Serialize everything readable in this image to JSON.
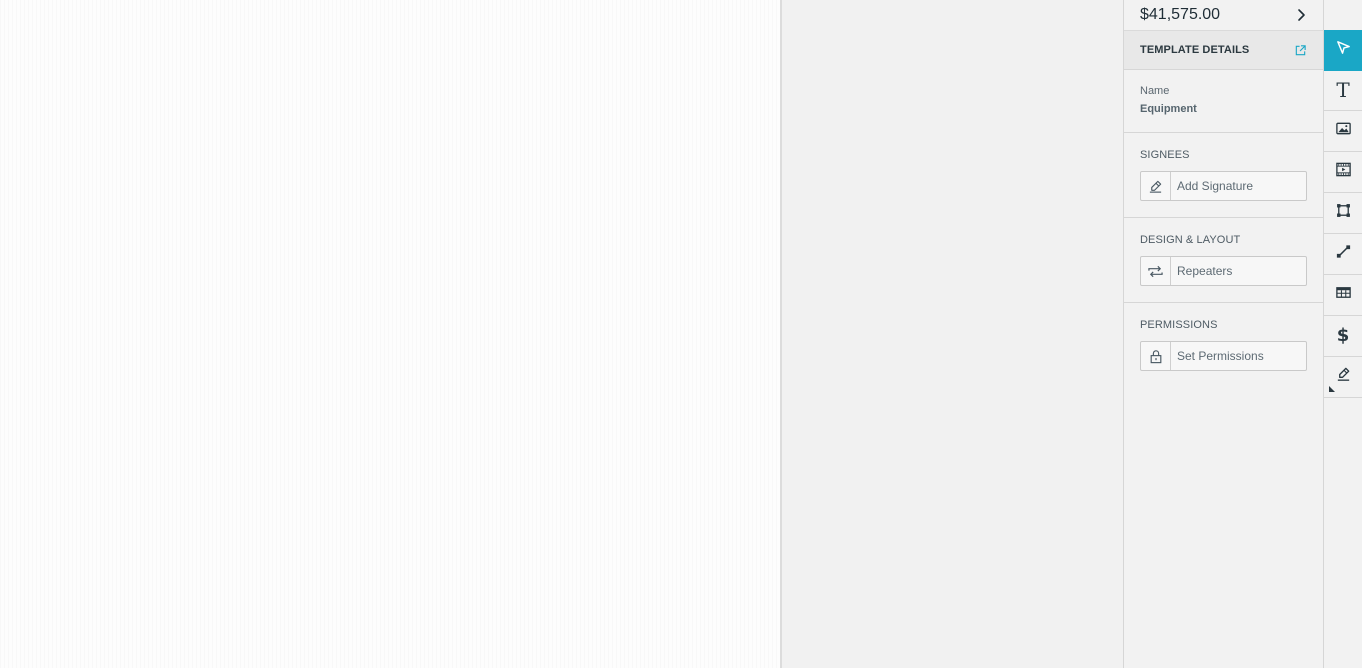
{
  "summary": {
    "total": "$41,575.00"
  },
  "template_details": {
    "title": "TEMPLATE DETAILS",
    "name_label": "Name",
    "name_value": "Equipment"
  },
  "sections": {
    "signees": {
      "label": "SIGNEES",
      "button": "Add Signature"
    },
    "design_layout": {
      "label": "DESIGN & LAYOUT",
      "button": "Repeaters"
    },
    "permissions": {
      "label": "PERMISSIONS",
      "button": "Set Permissions"
    }
  },
  "toolbar": {
    "tools": [
      "pointer-icon",
      "text-icon",
      "image-icon",
      "video-icon",
      "shape-icon",
      "line-icon",
      "table-icon",
      "dollar-icon",
      "signature-icon"
    ],
    "active_tool": "pointer-icon",
    "glyph_text": "T",
    "glyph_dollar": "$"
  },
  "colors": {
    "accent": "#1aa7c6",
    "panel_bg": "#f2f2f2",
    "text_dark": "#1f2d36"
  }
}
